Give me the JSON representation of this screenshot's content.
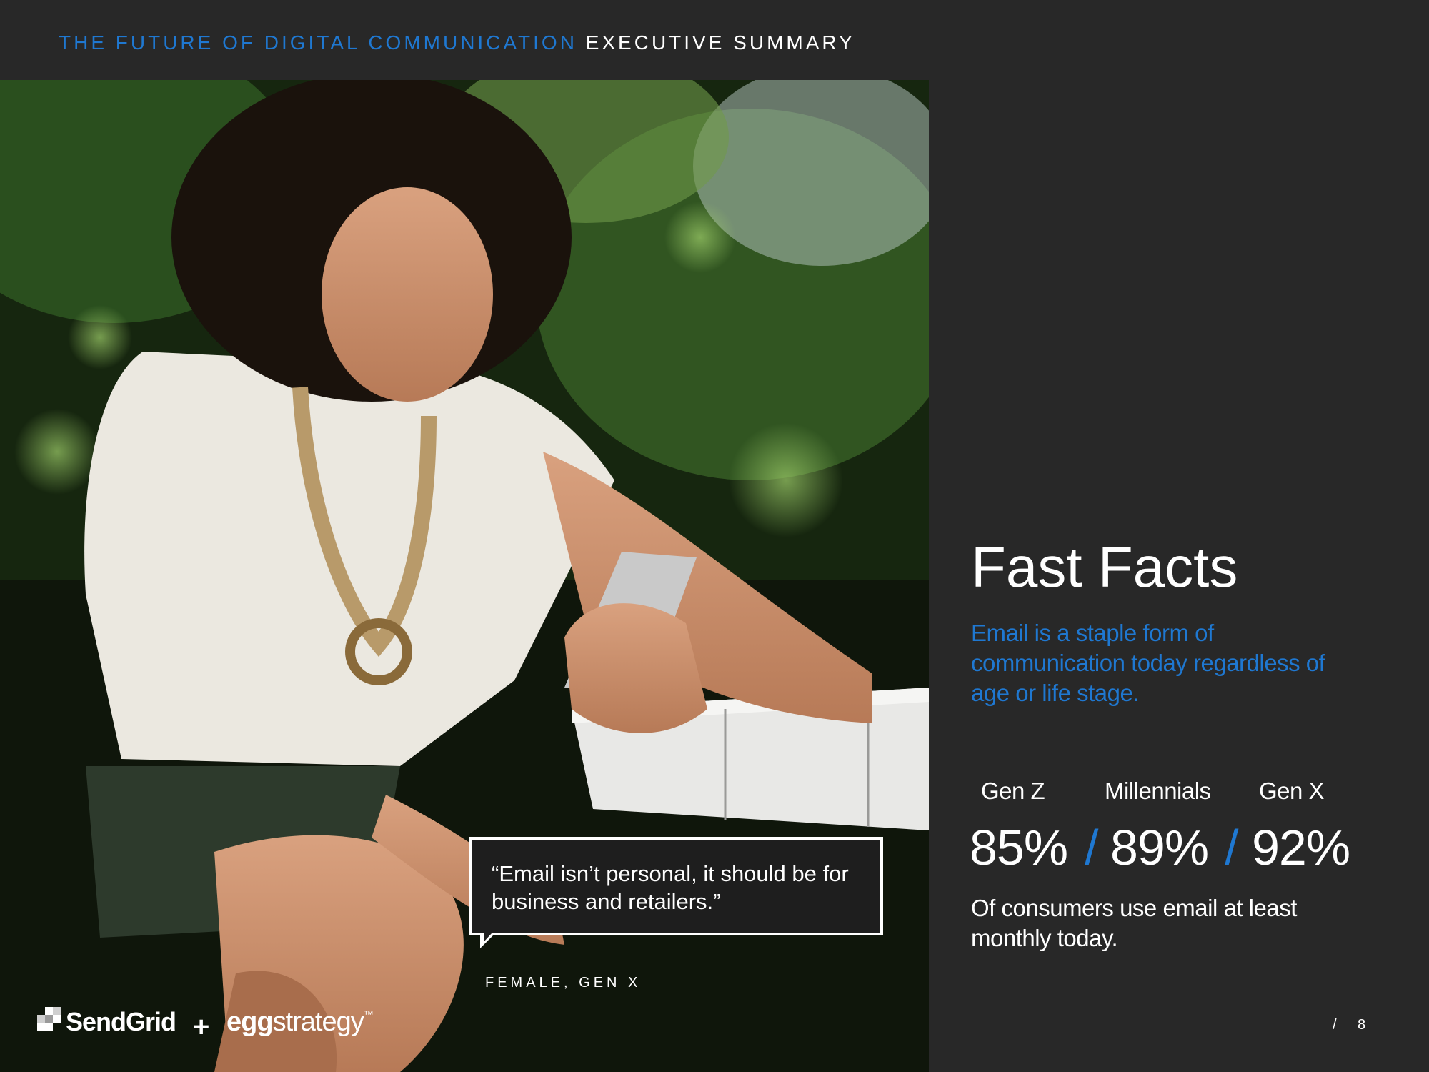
{
  "header": {
    "title_accent": "THE FUTURE OF DIGITAL COMMUNICATION",
    "title_plain": "EXECUTIVE SUMMARY"
  },
  "quote": {
    "text": "“Email isn’t personal, it should be for business and retailers.”",
    "attribution": "FEMALE, GEN X"
  },
  "logos": {
    "brand1": "SendGrid",
    "plus": "+",
    "brand2_bold": "egg",
    "brand2_rest": "strategy",
    "brand2_tm": "™"
  },
  "facts": {
    "title": "Fast Facts",
    "subtitle": "Email is a staple form of communication today regardless of age or life stage.",
    "groups": [
      {
        "label": "Gen Z",
        "value": "85%"
      },
      {
        "label": "Millennials",
        "value": "89%"
      },
      {
        "label": "Gen X",
        "value": "92%"
      }
    ],
    "separator": "/",
    "description": "Of consumers use email at least monthly today."
  },
  "page": {
    "separator": "/",
    "number": "8"
  },
  "colors": {
    "background": "#282828",
    "accent": "#1f78d1",
    "text": "#ffffff"
  }
}
